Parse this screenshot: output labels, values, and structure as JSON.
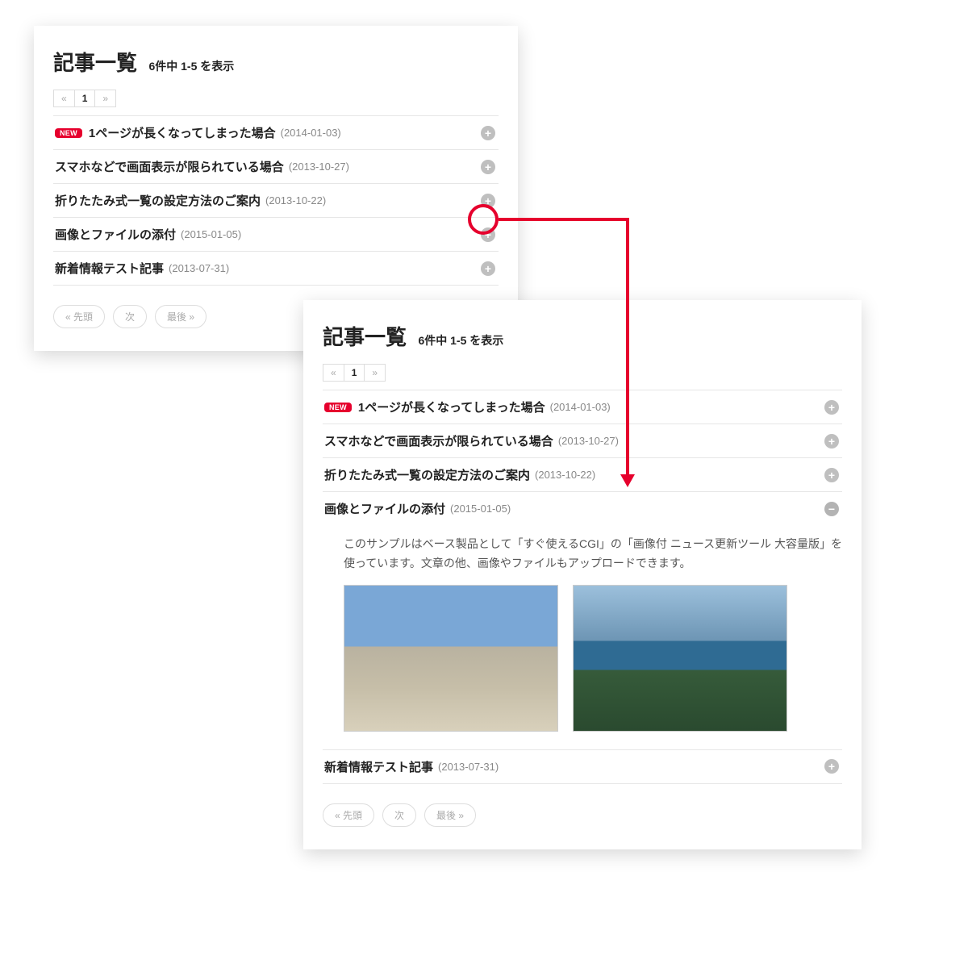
{
  "header": {
    "title": "記事一覧",
    "count": "6件中 1-5 を表示"
  },
  "paginator": {
    "prev": "«",
    "current": "1",
    "next": "»"
  },
  "badge": "NEW",
  "rows": [
    {
      "title": "1ページが長くなってしまった場合",
      "date": "(2014-01-03)",
      "new": true
    },
    {
      "title": "スマホなどで画面表示が限られている場合",
      "date": "(2013-10-27)",
      "new": false
    },
    {
      "title": "折りたたみ式一覧の設定方法のご案内",
      "date": "(2013-10-22)",
      "new": false
    },
    {
      "title": "画像とファイルの添付",
      "date": "(2015-01-05)",
      "new": false
    },
    {
      "title": "新着情報テスト記事",
      "date": "(2013-07-31)",
      "new": false
    }
  ],
  "expanded_body": "このサンプルはベース製品として「すぐ使えるCGI」の「画像付 ニュース更新ツール 大容量版」を使っています。文章の他、画像やファイルもアップロードできます。",
  "nav": {
    "first": "« 先頭",
    "next": "次",
    "last": "最後 »"
  },
  "icons": {
    "plus": "+",
    "minus": "−"
  }
}
